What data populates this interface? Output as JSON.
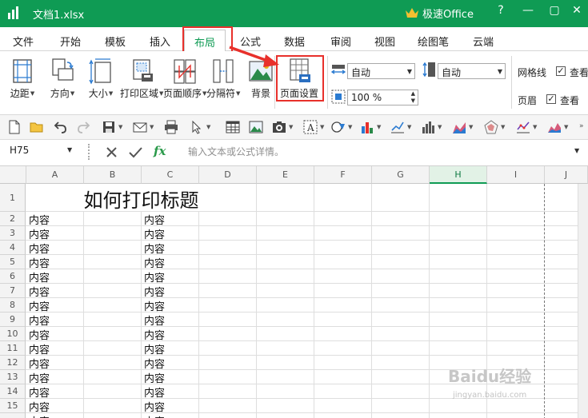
{
  "titlebar": {
    "doc_title": "文档1.xlsx",
    "brand": "极速Office",
    "help": "?",
    "minimize": "—",
    "restore": "▢",
    "close": "✕",
    "bg_color": "#0f9b54"
  },
  "tabs": [
    "文件",
    "开始",
    "模板",
    "插入",
    "布局",
    "公式",
    "数据",
    "审阅",
    "视图",
    "绘图笔",
    "云端"
  ],
  "active_tab": "布局",
  "ribbon": {
    "margins": "边距",
    "orientation": "方向",
    "size": "大小",
    "print_area": "打印区域",
    "page_order": "页面顺序",
    "separator": "分隔符",
    "background": "背景",
    "page_setup": "页面设置",
    "width_select": "自动",
    "height_select": "自动",
    "scale": "100 %",
    "gridlines": "网格线",
    "headings": "页眉",
    "view1": "查看",
    "view2": "查看"
  },
  "formula": {
    "cell_ref": "H75",
    "fx": "fx",
    "placeholder": "输入文本或公式详情。"
  },
  "sheet": {
    "columns": [
      "A",
      "B",
      "C",
      "D",
      "E",
      "F",
      "G",
      "H",
      "I",
      "J"
    ],
    "selected_column": "H",
    "rows": [
      "1",
      "2",
      "3",
      "4",
      "5",
      "6",
      "7",
      "8",
      "9",
      "10",
      "11",
      "12",
      "13",
      "14",
      "15"
    ],
    "title": "如何打印标题",
    "cell_text": "内容"
  },
  "watermark": {
    "text": "Baidu经验",
    "sub": "jingyan.baidu.com"
  },
  "annotation_color": "#e8302b"
}
